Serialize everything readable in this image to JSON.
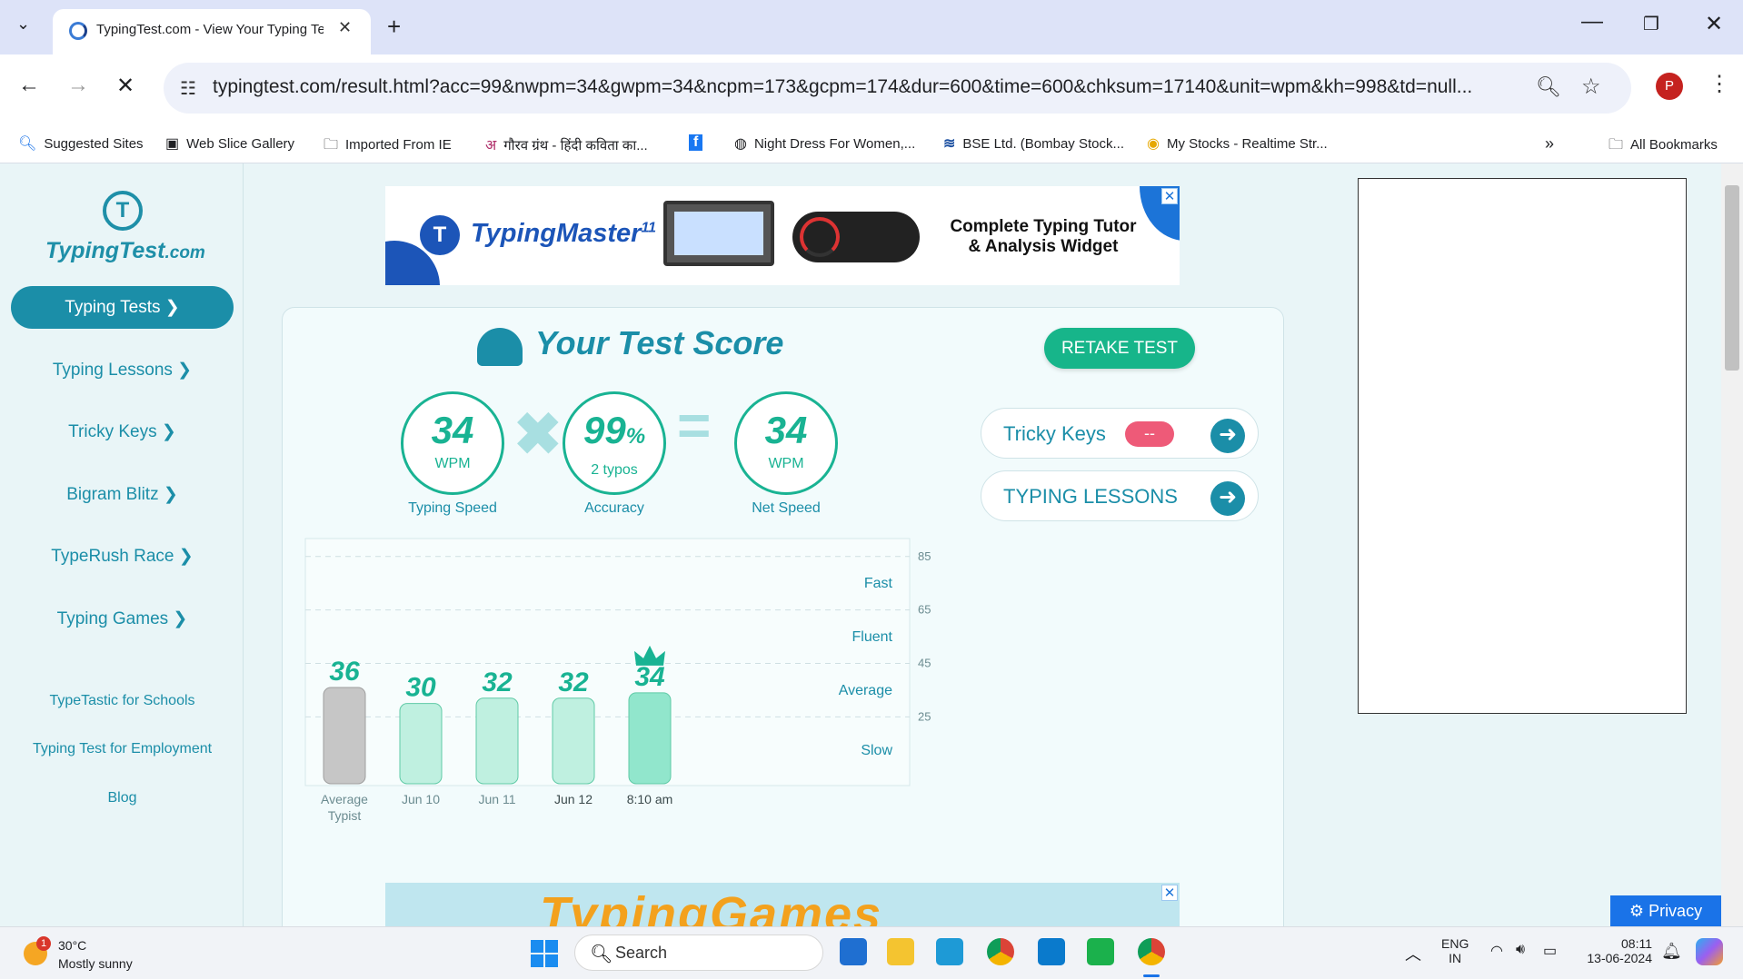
{
  "browser": {
    "tab_title": "TypingTest.com - View Your Typing Te",
    "url": "typingtest.com/result.html?acc=99&nwpm=34&gwpm=34&ncpm=173&gcpm=174&dur=600&time=600&chksum=17140&unit=wpm&kh=998&td=null...",
    "profile_initial": "P",
    "bookmarks": [
      "Suggested Sites",
      "Web Slice Gallery",
      "Imported From IE",
      "गौरव ग्रंथ - हिंदी कविता का...",
      "Night Dress For Women,...",
      "BSE Ltd. (Bombay Stock...",
      "My Stocks - Realtime Str..."
    ],
    "all_bookmarks": "All Bookmarks"
  },
  "sidebar": {
    "logo_name": "TypingTest",
    "logo_suffix": ".com",
    "active_item": "Typing Tests ❯",
    "items": [
      "Typing Lessons ❯",
      "Tricky Keys ❯",
      "Bigram Blitz ❯",
      "TypeRush Race ❯",
      "Typing Games ❯"
    ],
    "links": [
      "TypeTastic for Schools",
      "Typing Test for Employment",
      "Blog"
    ]
  },
  "ad_top": {
    "brand": "TypingMaster",
    "version": "11",
    "tagline_1": "Complete Typing Tutor",
    "tagline_2": "& Analysis Widget"
  },
  "score": {
    "title": "Your Test Score",
    "retake_label": "RETAKE TEST",
    "typing_speed": {
      "value": "34",
      "unit": "WPM",
      "caption": "Typing Speed"
    },
    "accuracy": {
      "value": "99",
      "unit": "%",
      "sub": "2 typos",
      "caption": "Accuracy"
    },
    "net_speed": {
      "value": "34",
      "unit": "WPM",
      "caption": "Net Speed"
    },
    "tricky_keys_label": "Tricky Keys",
    "tricky_keys_badge": "--",
    "typing_lessons_label": "TYPING LESSONS"
  },
  "chart_data": {
    "type": "bar",
    "categories": [
      "Average Typist",
      "Jun 10",
      "Jun 11",
      "Jun 12",
      "8:10 am"
    ],
    "values": [
      36,
      30,
      32,
      32,
      34
    ],
    "ylim": [
      0,
      85
    ],
    "y_ticks": [
      25,
      45,
      65,
      85
    ],
    "zones": [
      "Slow",
      "Average",
      "Fluent",
      "Fast"
    ],
    "grid": true,
    "highlight_index": 4,
    "colors": {
      "average": "#c6c6c6",
      "history": "#bff0e0",
      "current": "#91e6cc",
      "label": "#19b393"
    }
  },
  "ad_bottom": {
    "text": "TypingGames"
  },
  "privacy_label": "Privacy",
  "taskbar": {
    "temp": "30°C",
    "weather": "Mostly sunny",
    "weather_badge": "1",
    "search": "Search",
    "lang_1": "ENG",
    "lang_2": "IN",
    "time": "08:11",
    "date": "13-06-2024"
  }
}
